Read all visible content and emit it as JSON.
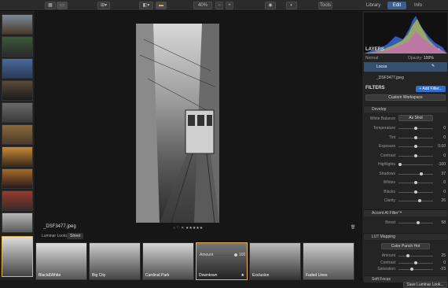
{
  "toolbar": {
    "zoom": "40%",
    "minus": "−",
    "plus": "+",
    "tools_label": "Tools",
    "tabs": [
      "Library",
      "Edit",
      "Info"
    ]
  },
  "filename": "_DSF3477.jpeg",
  "looks": {
    "label": "Luminar Looks:",
    "category": "Street",
    "items": [
      "Black&White",
      "Big City",
      "Cardinal Park",
      "Downtown",
      "Exclusion",
      "Faded Lines"
    ],
    "amount_label": "Amount",
    "amount_value": "100"
  },
  "rating_icons": "○ ♡ ✕ ★★★★★",
  "layers": {
    "title": "LAYERS",
    "blend": "Normal",
    "opacity_label": "Opacity:",
    "opacity_value": "100%",
    "layer_name": "Locos",
    "base_file": "_DSF3477.jpeg"
  },
  "filters": {
    "title": "FILTERS",
    "add_label": "+ Add Filter...",
    "workspace": "Custom Workspace",
    "develop": {
      "title": "Develop",
      "wb_label": "White Balance",
      "wb_value": "As Shot",
      "rows": [
        {
          "label": "Temperature",
          "value": "0",
          "pos": 0.5
        },
        {
          "label": "Tint",
          "value": "0",
          "pos": 0.5
        },
        {
          "label": "Exposure",
          "value": "0.00",
          "pos": 0.5
        },
        {
          "label": "Contrast",
          "value": "0",
          "pos": 0.5
        },
        {
          "label": "Highlights",
          "value": "-100",
          "pos": 0.0
        },
        {
          "label": "Shadows",
          "value": "37",
          "pos": 0.68
        },
        {
          "label": "Whites",
          "value": "0",
          "pos": 0.5
        },
        {
          "label": "Blacks",
          "value": "0",
          "pos": 0.5
        },
        {
          "label": "Clarity",
          "value": "26",
          "pos": 0.63
        }
      ]
    },
    "accent": {
      "title": "Accent AI Filter™",
      "label": "Boost",
      "value": "58",
      "pos": 0.58
    },
    "lut": {
      "title": "LUT Mapping",
      "preset": "Color Punch Hot",
      "rows": [
        {
          "label": "Amount",
          "value": "25",
          "pos": 0.25
        },
        {
          "label": "Contrast",
          "value": "0",
          "pos": 0.5
        },
        {
          "label": "Saturation",
          "value": "-23",
          "pos": 0.38
        }
      ]
    },
    "soft_focus": "Soft Focus",
    "save_label": "Save Luminar Look..."
  }
}
